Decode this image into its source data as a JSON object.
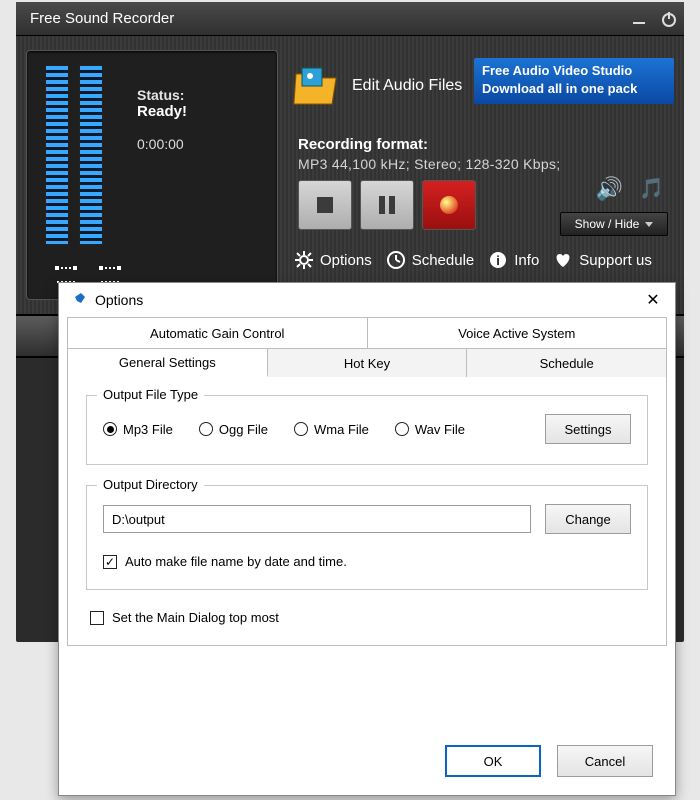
{
  "titlebar": {
    "title": "Free Sound Recorder"
  },
  "meter": {
    "status_label": "Status:",
    "status_value": "Ready!",
    "time": "0:00:00"
  },
  "edit": {
    "label": "Edit Audio Files"
  },
  "promo": {
    "line1": "Free Audio Video Studio",
    "line2": "Download all in one pack"
  },
  "format": {
    "label": "Recording format:",
    "value": "MP3 44,100 kHz; Stereo;  128-320 Kbps;"
  },
  "show_hide": "Show / Hide",
  "links": {
    "options": "Options",
    "schedule": "Schedule",
    "info": "Info",
    "support": "Support us"
  },
  "dialog": {
    "title": "Options",
    "tabs_outer": [
      "Automatic Gain Control",
      "Voice Active System"
    ],
    "tabs_inner": [
      "General Settings",
      "Hot Key",
      "Schedule"
    ],
    "filetype": {
      "legend": "Output File Type",
      "options": [
        "Mp3 File",
        "Ogg File",
        "Wma File",
        "Wav File"
      ],
      "selected": 0,
      "settings_btn": "Settings"
    },
    "outdir": {
      "legend": "Output Directory",
      "value": "D:\\output",
      "change_btn": "Change",
      "auto_name": "Auto make file name by date and time.",
      "auto_name_checked": true
    },
    "topmost": {
      "label": "Set the Main Dialog top most",
      "checked": false
    },
    "ok": "OK",
    "cancel": "Cancel"
  }
}
